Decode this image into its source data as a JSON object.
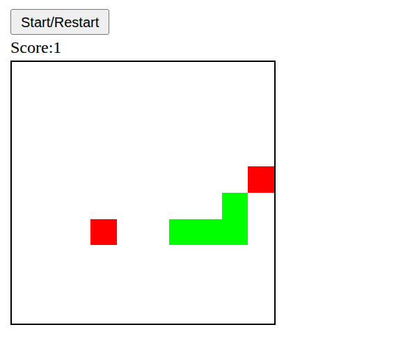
{
  "button": {
    "label": "Start/Restart"
  },
  "score": {
    "text": "Score:1"
  },
  "board": {
    "cells": [
      {
        "col": 3,
        "row": 6,
        "color": "#ff0000"
      },
      {
        "col": 9,
        "row": 4,
        "color": "#ff0000"
      },
      {
        "col": 6,
        "row": 6,
        "color": "#00ff00"
      },
      {
        "col": 7,
        "row": 6,
        "color": "#00ff00"
      },
      {
        "col": 8,
        "row": 6,
        "color": "#00ff00"
      },
      {
        "col": 8,
        "row": 5,
        "color": "#00ff00"
      }
    ]
  }
}
